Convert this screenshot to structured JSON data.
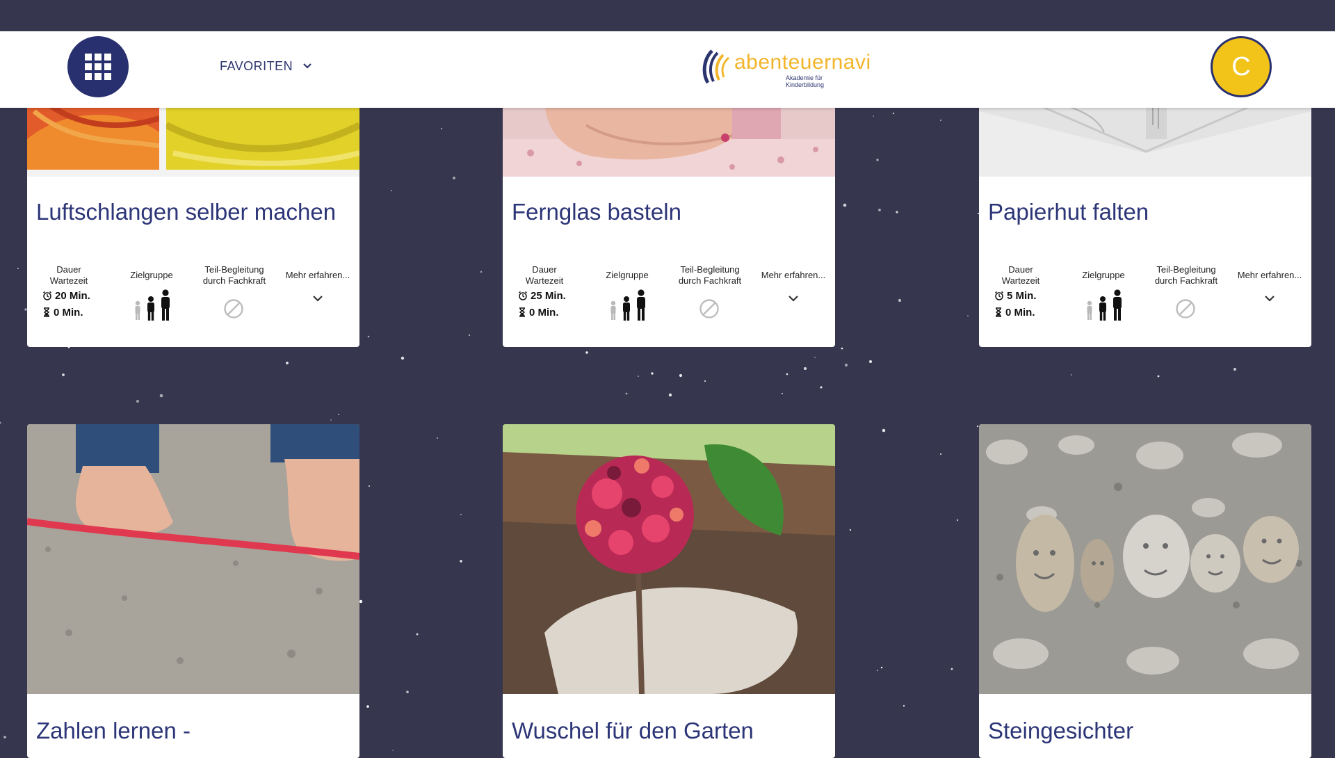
{
  "header": {
    "favorites_label": "FAVORITEN",
    "logo_text": "abenteuernavi",
    "logo_subtitle": "Akademie für Kinderbildung",
    "avatar_initial": "C"
  },
  "info_labels": {
    "duration": "Dauer",
    "wait": "Wartezeit",
    "target_group": "Zielgruppe",
    "guidance_line1": "Teil-Begleitung",
    "guidance_line2": "durch Fachkraft",
    "more": "Mehr erfahren..."
  },
  "cards": [
    {
      "title": "Luftschlangen selber machen",
      "duration": "20 Min.",
      "wait": "0 Min."
    },
    {
      "title": "Fernglas basteln",
      "duration": "25 Min.",
      "wait": "0 Min."
    },
    {
      "title": "Papierhut falten",
      "duration": "5 Min.",
      "wait": "0 Min."
    },
    {
      "title": "Zahlen lernen -"
    },
    {
      "title": "Wuschel für den Garten"
    },
    {
      "title": "Steingesichter"
    }
  ],
  "colors": {
    "background": "#37364f",
    "brand_navy": "#28306f",
    "title_blue": "#2c3577",
    "avatar_yellow": "#f2c319",
    "logo_yellow": "#f2b52a"
  }
}
